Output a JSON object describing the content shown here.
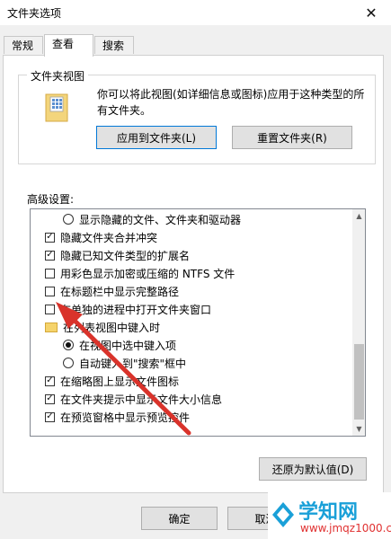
{
  "window": {
    "title": "文件夹选项",
    "close_glyph": "✕"
  },
  "tabs": [
    {
      "label": "常规",
      "active": false
    },
    {
      "label": "查看",
      "active": true
    },
    {
      "label": "搜索",
      "active": false
    }
  ],
  "folder_view": {
    "title": "文件夹视图",
    "description": "你可以将此视图(如详细信息或图标)应用于这种类型的所有文件夹。",
    "apply_label": "应用到文件夹(L)",
    "reset_label": "重置文件夹(R)"
  },
  "advanced": {
    "label": "高级设置:",
    "items": [
      {
        "type": "radio",
        "checked": false,
        "label": "显示隐藏的文件、文件夹和驱动器"
      },
      {
        "type": "checkbox",
        "checked": true,
        "label": "隐藏文件夹合并冲突"
      },
      {
        "type": "checkbox",
        "checked": true,
        "label": "隐藏已知文件类型的扩展名"
      },
      {
        "type": "checkbox",
        "checked": false,
        "label": "用彩色显示加密或压缩的 NTFS 文件"
      },
      {
        "type": "checkbox",
        "checked": false,
        "label": "在标题栏中显示完整路径"
      },
      {
        "type": "checkbox",
        "checked": false,
        "label": "在单独的进程中打开文件夹窗口"
      },
      {
        "type": "folder",
        "label": "在列表视图中键入时"
      },
      {
        "type": "radio",
        "checked": true,
        "label": "在视图中选中键入项"
      },
      {
        "type": "radio",
        "checked": false,
        "label": "自动键入到\"搜索\"框中"
      },
      {
        "type": "checkbox",
        "checked": true,
        "label": "在缩略图上显示文件图标"
      },
      {
        "type": "checkbox",
        "checked": true,
        "label": "在文件夹提示中显示文件大小信息"
      },
      {
        "type": "checkbox",
        "checked": true,
        "label": "在预览窗格中显示预览控件"
      }
    ],
    "restore_label": "还原为默认值(D)"
  },
  "footer": {
    "ok_label": "确定",
    "cancel_label": "取消"
  },
  "watermark": {
    "brand": "学知网",
    "url": "www.jmqz1000.com"
  },
  "colors": {
    "accent": "#0078d7",
    "annotation_arrow": "#d9332b",
    "watermark_blue": "#1aa0d8",
    "watermark_red": "#e03030"
  }
}
